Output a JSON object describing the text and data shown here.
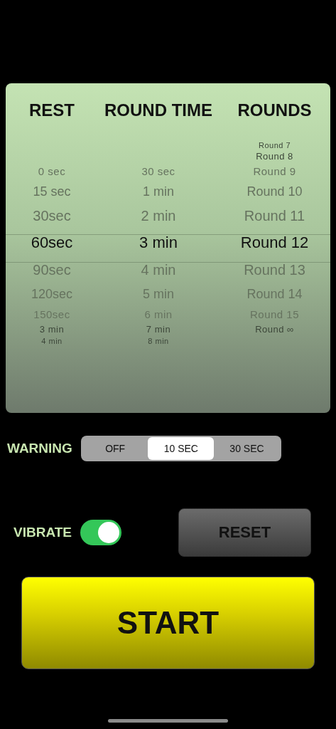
{
  "picker": {
    "headers": [
      "REST",
      "ROUND TIME",
      "ROUNDS"
    ],
    "columns": [
      {
        "items": [
          {
            "label": "0 sec",
            "selected": false
          },
          {
            "label": "15 sec",
            "selected": false
          },
          {
            "label": "30sec",
            "selected": false
          },
          {
            "label": "60sec",
            "selected": true
          },
          {
            "label": "90sec",
            "selected": false
          },
          {
            "label": "120sec",
            "selected": false
          },
          {
            "label": "150sec",
            "selected": false
          },
          {
            "label": "3 min",
            "selected": false
          },
          {
            "label": "4 min",
            "selected": false
          }
        ]
      },
      {
        "items": [
          {
            "label": "30 sec",
            "selected": false
          },
          {
            "label": "1 min",
            "selected": false
          },
          {
            "label": "2 min",
            "selected": false
          },
          {
            "label": "3 min",
            "selected": true
          },
          {
            "label": "4 min",
            "selected": false
          },
          {
            "label": "5 min",
            "selected": false
          },
          {
            "label": "6 min",
            "selected": false
          },
          {
            "label": "7 min",
            "selected": false
          },
          {
            "label": "8 min",
            "selected": false
          }
        ]
      },
      {
        "items": [
          {
            "label": "Round 7",
            "selected": false
          },
          {
            "label": "Round 8",
            "selected": false
          },
          {
            "label": "Round 9",
            "selected": false
          },
          {
            "label": "Round 10",
            "selected": false
          },
          {
            "label": "Round 11",
            "selected": false
          },
          {
            "label": "Round 12",
            "selected": true
          },
          {
            "label": "Round 13",
            "selected": false
          },
          {
            "label": "Round 14",
            "selected": false
          },
          {
            "label": "Round 15",
            "selected": false
          },
          {
            "label": "Round ∞",
            "selected": false
          }
        ]
      }
    ]
  },
  "warning": {
    "label": "WARNING",
    "options": [
      {
        "label": "OFF",
        "selected": false
      },
      {
        "label": "10 SEC",
        "selected": true
      },
      {
        "label": "30 SEC",
        "selected": false
      }
    ]
  },
  "vibrate": {
    "label": "VIBRATE",
    "on": true
  },
  "reset_button": "RESET",
  "start_button": "START"
}
